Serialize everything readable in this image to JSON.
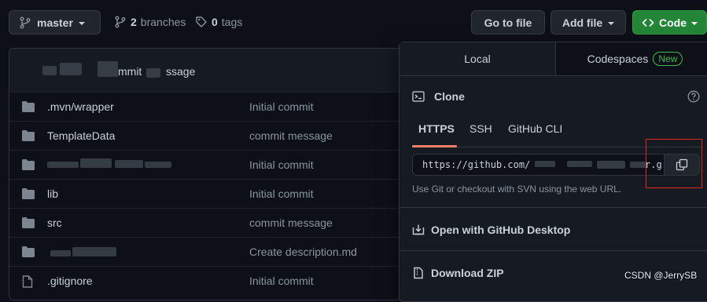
{
  "toolbar": {
    "branch": "master",
    "branches_count": "2",
    "branches_label": "branches",
    "tags_count": "0",
    "tags_label": "tags",
    "go_to_file": "Go to file",
    "add_file": "Add file",
    "code": "Code"
  },
  "commit_header": {
    "message_fragment": "mmit",
    "message_tail": "ssage"
  },
  "files": [
    {
      "name": ".mvn/wrapper",
      "type": "folder",
      "commit": "Initial commit"
    },
    {
      "name": "TemplateData",
      "type": "folder",
      "commit": "commit message"
    },
    {
      "name": "",
      "type": "folder",
      "commit": "Initial commit"
    },
    {
      "name": "lib",
      "type": "folder",
      "commit": "Initial commit"
    },
    {
      "name": "src",
      "type": "folder",
      "commit": "commit message"
    },
    {
      "name": "",
      "type": "folder",
      "commit": "Create description.md"
    },
    {
      "name": ".gitignore",
      "type": "file",
      "commit": "Initial commit"
    }
  ],
  "panel": {
    "tab_local": "Local",
    "tab_codespaces": "Codespaces",
    "badge_new": "New",
    "clone_title": "Clone",
    "protocols": [
      "HTTPS",
      "SSH",
      "GitHub CLI"
    ],
    "active_protocol": "HTTPS",
    "url_prefix": "https://github.com/",
    "url_end": "r.g",
    "hint": "Use Git or checkout with SVN using the web URL.",
    "open_desktop": "Open with GitHub Desktop",
    "download_zip": "Download ZIP"
  },
  "watermark": "CSDN @JerrySB",
  "colors": {
    "code_button": "#238636",
    "highlight_box": "#e5231f",
    "active_tab_underline": "#f78166"
  }
}
